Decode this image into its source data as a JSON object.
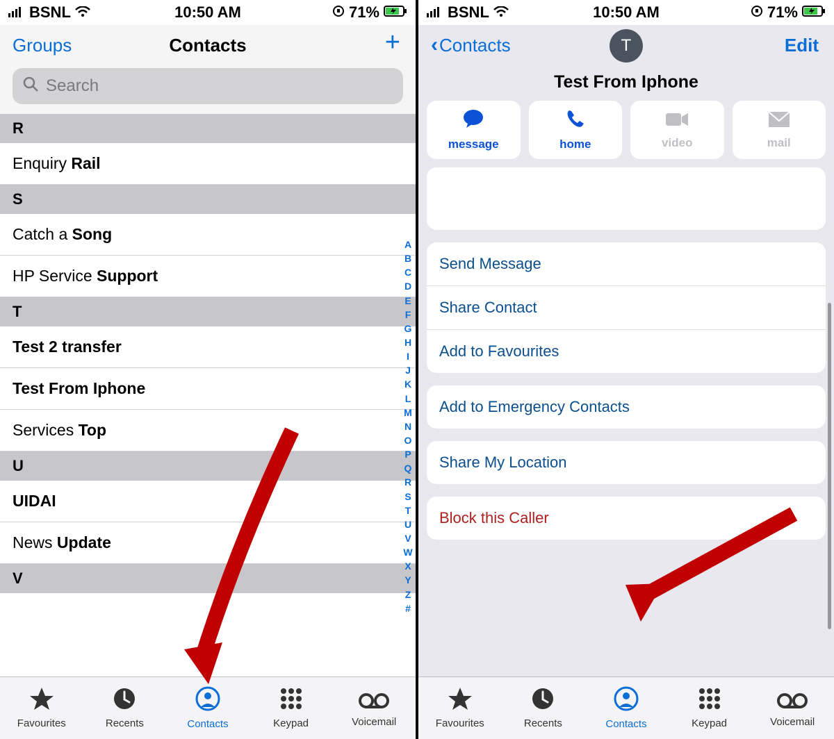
{
  "statusbar": {
    "carrier": "BSNL",
    "time": "10:50 AM",
    "battery": "71%"
  },
  "screen1": {
    "nav": {
      "left": "Groups",
      "title": "Contacts"
    },
    "search_placeholder": "Search",
    "sections": [
      {
        "letter": "R",
        "rows": [
          {
            "pre": "Enquiry ",
            "bold": "Rail"
          }
        ]
      },
      {
        "letter": "S",
        "rows": [
          {
            "pre": "Catch a ",
            "bold": "Song"
          },
          {
            "pre": "HP Service ",
            "bold": "Support"
          }
        ]
      },
      {
        "letter": "T",
        "rows": [
          {
            "pre": "",
            "bold": "Test 2 transfer"
          },
          {
            "pre": "",
            "bold": "Test From Iphone"
          },
          {
            "pre": "Services ",
            "bold": "Top"
          }
        ]
      },
      {
        "letter": "U",
        "rows": [
          {
            "pre": "",
            "bold": "UIDAI"
          },
          {
            "pre": "News ",
            "bold": "Update"
          }
        ]
      },
      {
        "letter": "V",
        "rows": []
      }
    ],
    "index": [
      "A",
      "B",
      "C",
      "D",
      "E",
      "F",
      "G",
      "H",
      "I",
      "J",
      "K",
      "L",
      "M",
      "N",
      "O",
      "P",
      "Q",
      "R",
      "S",
      "T",
      "U",
      "V",
      "W",
      "X",
      "Y",
      "Z",
      "#"
    ]
  },
  "screen2": {
    "nav": {
      "back": "Contacts",
      "edit": "Edit"
    },
    "avatar_letter": "T",
    "contact_name": "Test From Iphone",
    "actions": [
      {
        "label": "message",
        "active": true,
        "icon": "message"
      },
      {
        "label": "home",
        "active": true,
        "icon": "phone"
      },
      {
        "label": "video",
        "active": false,
        "icon": "video"
      },
      {
        "label": "mail",
        "active": false,
        "icon": "mail"
      }
    ],
    "groups": [
      {
        "rows": [
          {
            "label": "Send Message"
          },
          {
            "label": "Share Contact"
          },
          {
            "label": "Add to Favourites"
          }
        ]
      },
      {
        "rows": [
          {
            "label": "Add to Emergency Contacts"
          }
        ]
      },
      {
        "rows": [
          {
            "label": "Share My Location"
          }
        ]
      },
      {
        "rows": [
          {
            "label": "Block this Caller",
            "danger": true
          }
        ]
      }
    ]
  },
  "tabs": [
    {
      "label": "Favourites",
      "icon": "star"
    },
    {
      "label": "Recents",
      "icon": "clock"
    },
    {
      "label": "Contacts",
      "icon": "contact",
      "active": true
    },
    {
      "label": "Keypad",
      "icon": "keypad"
    },
    {
      "label": "Voicemail",
      "icon": "voicemail"
    }
  ]
}
